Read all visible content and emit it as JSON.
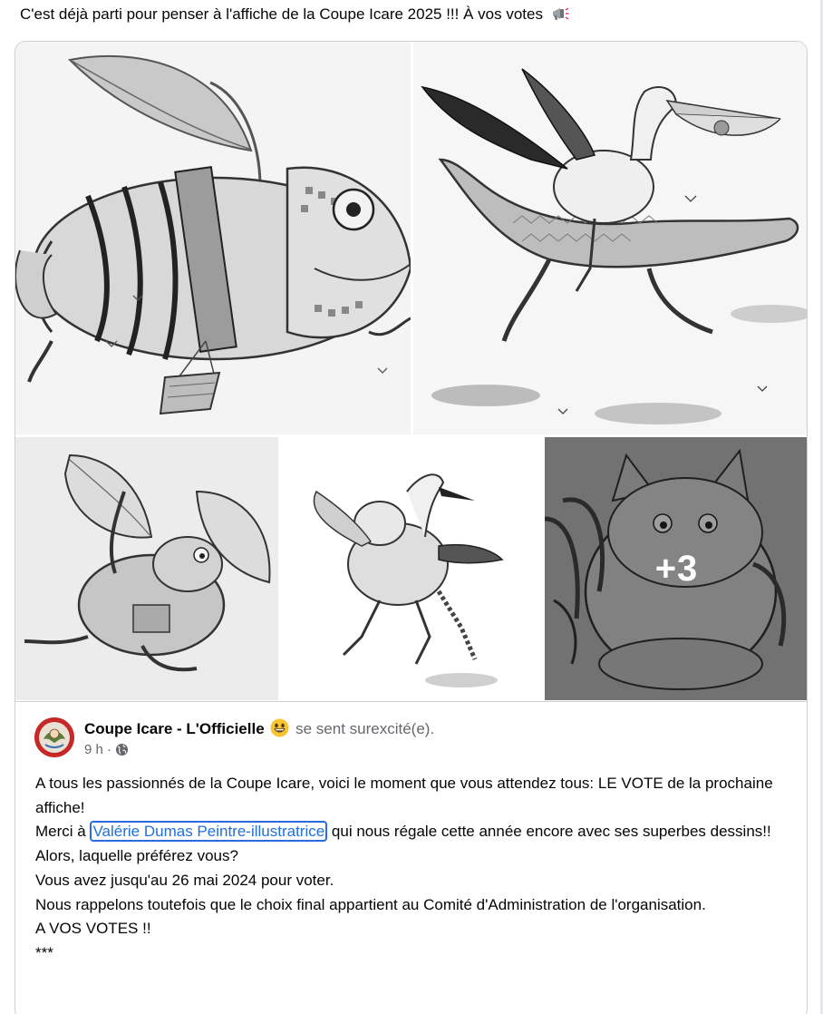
{
  "caption": {
    "text": "C'est déjà parti pour penser à l'affiche de la Coupe Icare 2025 !!! À vos votes",
    "icon": "megaphone-icon"
  },
  "gallery": {
    "more_count": "+3",
    "photos": [
      {
        "subject": "chameleon-with-wings-and-basket"
      },
      {
        "subject": "pelican-riding-crocodile"
      },
      {
        "subject": "frog-with-leaf-wings"
      },
      {
        "subject": "two-birds-running"
      },
      {
        "subject": "cat-with-bird"
      }
    ]
  },
  "post": {
    "author": "Coupe Icare - L'Officielle",
    "feeling_icon": "grinning-face-icon",
    "feeling": "se sent surexcité(e).",
    "time": "9 h",
    "separator": "·",
    "audience_icon": "globe-icon",
    "lines": {
      "l1": "A tous les passionnés de la Coupe Icare, voici le moment que vous attendez tous: LE VOTE de la prochaine affiche!",
      "l2_before": "Merci à ",
      "mention": "Valérie Dumas Peintre-illustratrice",
      "l2_after": " qui nous régale cette année encore avec ses superbes dessins!!",
      "l3": "Alors, laquelle préférez vous?",
      "l4": "Vous avez jusqu'au 26 mai 2024 pour voter.",
      "l5": "Nous rappelons toutefois que le choix final appartient au Comité d'Administration de l'organisation.",
      "l6": "A VOS VOTES !!",
      "l7": "***"
    }
  }
}
